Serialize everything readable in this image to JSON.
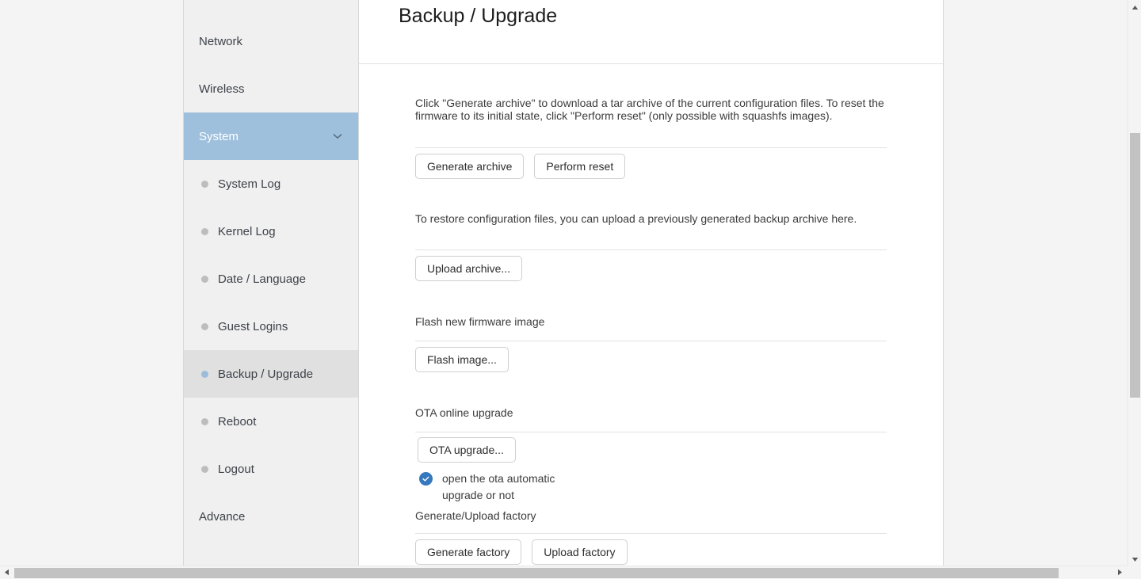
{
  "sidebar": {
    "top_items": [
      {
        "label": "Network",
        "icon": "",
        "type": "group",
        "active": false
      },
      {
        "label": "Wireless",
        "icon": "",
        "type": "group",
        "active": false
      },
      {
        "label": "System",
        "icon": "chevron-down-icon",
        "type": "group",
        "active": true
      }
    ],
    "children": [
      {
        "label": "System Log",
        "selected": false
      },
      {
        "label": "Kernel Log",
        "selected": false
      },
      {
        "label": "Date / Language",
        "selected": false
      },
      {
        "label": "Guest Logins",
        "selected": false
      },
      {
        "label": "Backup / Upgrade",
        "selected": true
      },
      {
        "label": "Reboot",
        "selected": false
      },
      {
        "label": "Logout",
        "selected": false
      }
    ],
    "bottom_items": [
      {
        "label": "Advance",
        "type": "group",
        "active": false
      }
    ],
    "colors": {
      "active_group_bg": "#9fc0dd",
      "selected_child_bg": "#e0e0e0",
      "selected_dot": "#9bbcda",
      "dot": "#bdbdbd",
      "background": "#f0f0f0"
    }
  },
  "main": {
    "title": "Backup / Upgrade",
    "sections": {
      "backup": {
        "description": "Click \"Generate archive\" to download a tar archive of the current configuration files. To reset the firmware to its initial state, click \"Perform reset\" (only possible with squashfs images).",
        "generate_archive_label": "Generate archive",
        "perform_reset_label": "Perform reset"
      },
      "restore": {
        "description": "To restore configuration files, you can upload a previously generated backup archive here.",
        "upload_archive_label": "Upload archive..."
      },
      "flash": {
        "title": "Flash new firmware image",
        "flash_image_label": "Flash image..."
      },
      "ota": {
        "title": "OTA online upgrade",
        "ota_upgrade_label": "OTA upgrade...",
        "checkbox_label": "open the ota automatic upgrade or not",
        "checkbox_checked": true,
        "checkbox_color": "#3578bd"
      },
      "factory": {
        "title": "Generate/Upload factory",
        "generate_factory_label": "Generate factory",
        "upload_factory_label": "Upload factory"
      }
    }
  },
  "scrollbars": {
    "vertical": {
      "up_icon": "triangle-up-icon",
      "down_icon": "triangle-down-icon",
      "thumb_color": "#c2c2c2"
    },
    "horizontal": {
      "left_icon": "triangle-left-icon",
      "right_icon": "triangle-right-icon",
      "thumb_color": "#c2c2c2"
    }
  }
}
